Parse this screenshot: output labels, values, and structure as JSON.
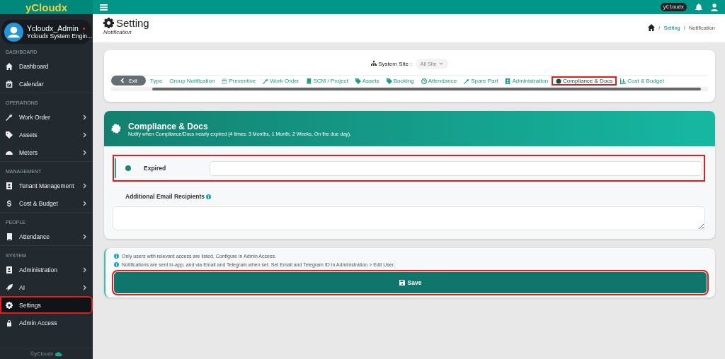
{
  "brand": "yCloudx",
  "user": {
    "name": "Ycloudx_Admin",
    "role": "Ycloudx System Engin...",
    "online": true
  },
  "sidebar": {
    "sections": [
      {
        "title": "DASHBOARD",
        "items": [
          {
            "label": "Dashboard",
            "has_submenu": false,
            "selected": false,
            "highlighted": false
          },
          {
            "label": "Calendar",
            "has_submenu": false,
            "selected": false,
            "highlighted": false
          }
        ]
      },
      {
        "title": "OPERATIONS",
        "items": [
          {
            "label": "Work Order",
            "has_submenu": true,
            "selected": false,
            "highlighted": false
          },
          {
            "label": "Assets",
            "has_submenu": true,
            "selected": false,
            "highlighted": false
          },
          {
            "label": "Meters",
            "has_submenu": true,
            "selected": false,
            "highlighted": false
          }
        ]
      },
      {
        "title": "MANAGEMENT",
        "items": [
          {
            "label": "Tenant Management",
            "has_submenu": true,
            "selected": false,
            "highlighted": false
          },
          {
            "label": "Cost & Budget",
            "has_submenu": true,
            "selected": false,
            "highlighted": false
          }
        ]
      },
      {
        "title": "PEOPLE",
        "items": [
          {
            "label": "Attendance",
            "has_submenu": true,
            "selected": false,
            "highlighted": false
          }
        ]
      },
      {
        "title": "SYSTEM",
        "items": [
          {
            "label": "Administration",
            "has_submenu": true,
            "selected": false,
            "highlighted": false
          },
          {
            "label": "AI",
            "has_submenu": true,
            "selected": false,
            "highlighted": false
          },
          {
            "label": "Settings",
            "has_submenu": false,
            "selected": true,
            "highlighted": true
          },
          {
            "label": "Admin Access",
            "has_submenu": false,
            "selected": false,
            "highlighted": false
          }
        ]
      }
    ],
    "footer": "©yCloudx"
  },
  "topbar": {
    "badge": "yCloudx"
  },
  "page": {
    "title": "Setting",
    "subtitle": "Notification",
    "breadcrumb": [
      "Setting",
      "Notification"
    ],
    "breadcrumb_separator": "/"
  },
  "filter": {
    "label": "System Site :",
    "value": "All Site"
  },
  "exit_button": "Exit",
  "tabs": [
    {
      "label": "Type",
      "selected": false,
      "highlighted": false
    },
    {
      "label": "Group Notification",
      "selected": false,
      "highlighted": false
    },
    {
      "label": "Preventive",
      "selected": false,
      "highlighted": false
    },
    {
      "label": "Work Order",
      "selected": false,
      "highlighted": false
    },
    {
      "label": "SCM / Project",
      "selected": false,
      "highlighted": false
    },
    {
      "label": "Assets",
      "selected": false,
      "highlighted": false
    },
    {
      "label": "Booking",
      "selected": false,
      "highlighted": false
    },
    {
      "label": "Attendance",
      "selected": false,
      "highlighted": false
    },
    {
      "label": "Spare Part",
      "selected": false,
      "highlighted": false
    },
    {
      "label": "Administration",
      "selected": false,
      "highlighted": false
    },
    {
      "label": "Compliance & Docs",
      "selected": true,
      "highlighted": true
    },
    {
      "label": "Cost & Budget",
      "selected": false,
      "highlighted": false
    }
  ],
  "section": {
    "title": "Compliance & Docs",
    "description": "Notify when Compliance/Docs nearly expired (4 times: 3 Months, 1 Month, 2 Weeks, On the due day).",
    "rows": [
      {
        "label": "Expired",
        "highlighted": true
      }
    ],
    "email_label": "Additional Email Recipients"
  },
  "notes": [
    "Only users with relevant access are listed. Configure in Admin Access.",
    "Notifications are sent in-app, and via Email and Telegram when set. Set Email and Telegram ID in Administration > Edit User."
  ],
  "save_button": {
    "label": "Save",
    "highlighted": true
  }
}
